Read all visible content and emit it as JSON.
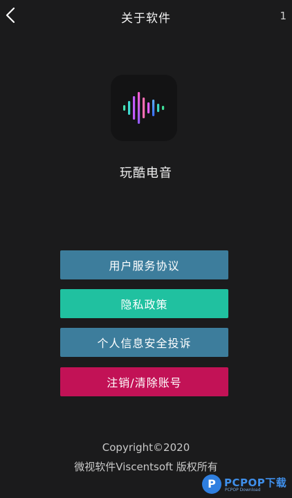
{
  "header": {
    "title": "关于软件",
    "corner_number": "1",
    "back_icon": "chevron-left-icon"
  },
  "app": {
    "logo_icon": "sound-wave-icon",
    "name": "玩酷电音"
  },
  "menu": {
    "user_agreement": "用户服务协议",
    "privacy_policy": "隐私政策",
    "personal_info_complaint": "个人信息安全投诉",
    "cancel_account": "注销/清除账号"
  },
  "colors": {
    "background": "#1b1b1c",
    "blue_button": "#3d7d9c",
    "green_button": "#20c1a0",
    "red_button": "#c21256",
    "watermark_blue": "#3f8fea"
  },
  "footer": {
    "copyright": "Copyright©2020",
    "owner": "微视软件Viscentsoft 版权所有"
  },
  "watermark": {
    "mark": "P",
    "text": "PCPOP下载",
    "sub": "PCPOP Download"
  }
}
